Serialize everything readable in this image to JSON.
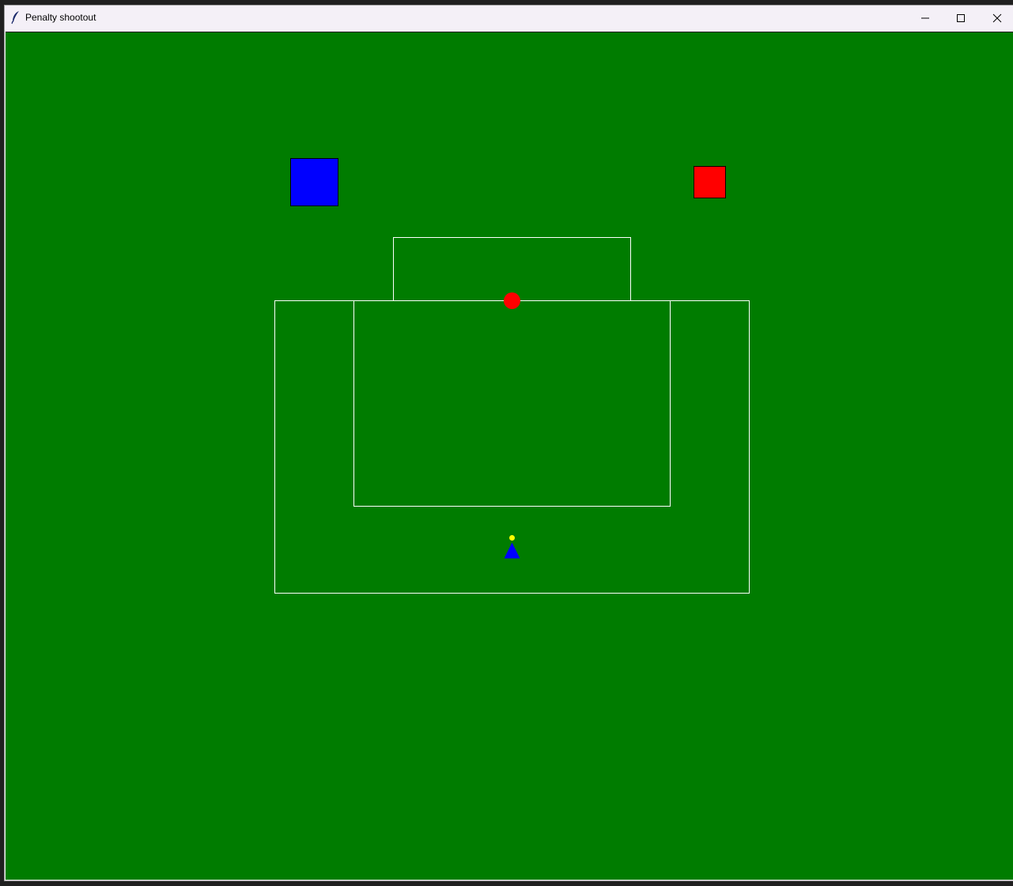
{
  "window": {
    "title": "Penalty shootout"
  },
  "titlebar_icons": {
    "app": "feather-icon",
    "minimize": "minimize-icon",
    "maximize": "maximize-icon",
    "close": "close-icon"
  },
  "game": {
    "field_color": "#007c00",
    "line_color": "#ffffff",
    "team_a_color": "#0000ff",
    "team_b_color": "#ff0000",
    "ball_color": "#ffff00"
  }
}
